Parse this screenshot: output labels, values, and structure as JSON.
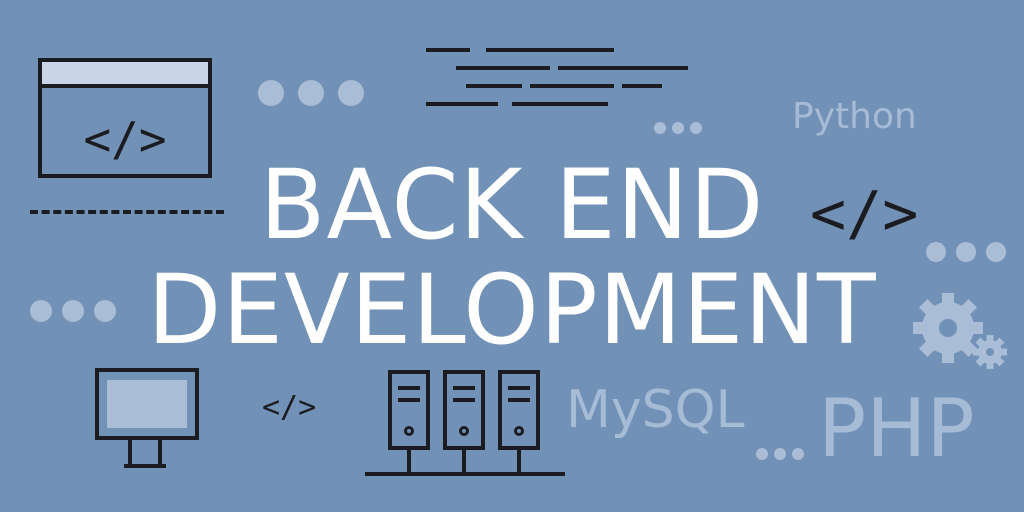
{
  "headline": {
    "line1": "BACK END",
    "line2": "DEVELOPMENT"
  },
  "tech_labels": {
    "python": "Python",
    "mysql": "MySQL",
    "php": "PHP"
  },
  "code_symbols": {
    "browser": "</>",
    "right": "</>",
    "small": "</>"
  },
  "icons": [
    "browser-window-icon",
    "monitor-icon",
    "server-rack-icon",
    "gear-icon",
    "code-lines-icon",
    "dots-icon"
  ],
  "colors": {
    "background": "#7191b6",
    "text_primary": "#ffffff",
    "text_muted": "#a6bbd6",
    "line_dark": "#1b1c22"
  }
}
